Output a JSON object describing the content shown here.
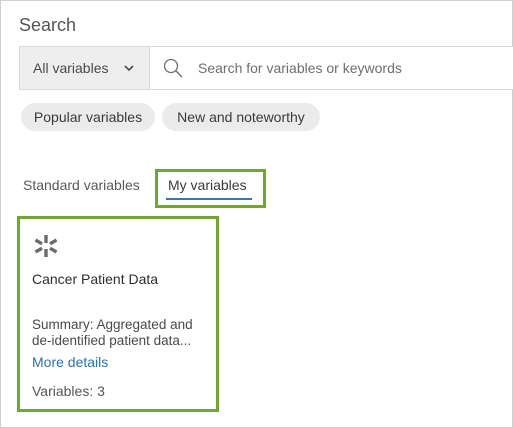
{
  "panel": {
    "title": "Search"
  },
  "search": {
    "scope_value": "All variables",
    "placeholder": "Search for variables or keywords",
    "value": ""
  },
  "chips": [
    {
      "label": "Popular variables"
    },
    {
      "label": "New and noteworthy"
    }
  ],
  "tabs": [
    {
      "label": "Standard variables",
      "selected": false
    },
    {
      "label": "My variables",
      "selected": true
    }
  ],
  "card": {
    "icon": "data-collection-icon",
    "title": "Cancer Patient Data",
    "summary_line1": "Summary: Aggregated and",
    "summary_line2": "de-identified patient data...",
    "link": "More details",
    "variables": "Variables: 3"
  },
  "colors": {
    "highlight": "#72a62e",
    "link": "#2b73ad",
    "tab_underline": "#2b7bb9",
    "chip_bg": "#ebebeb"
  }
}
